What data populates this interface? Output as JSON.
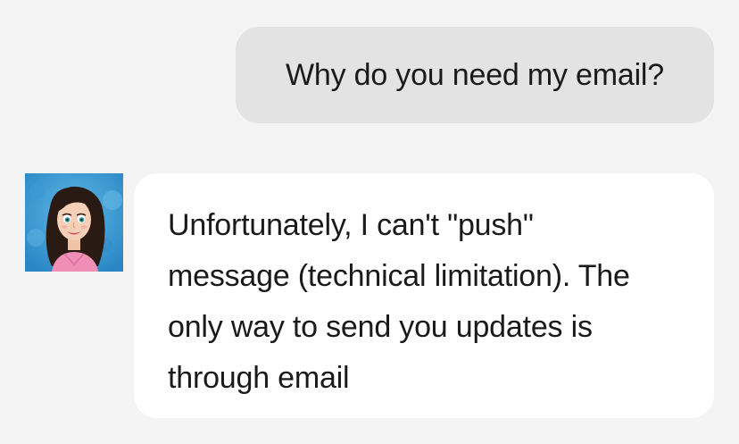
{
  "conversation": {
    "user_message": {
      "text": "Why do you need my email?"
    },
    "bot_message": {
      "avatar_icon": "cartoon-woman-avatar",
      "text": "Unfortunately, I can't \"push\"\nmessage (technical limitation). The\nonly way to send you updates is\nthrough email"
    }
  },
  "colors": {
    "background": "#f4f4f4",
    "user_bubble": "#e3e3e3",
    "bot_bubble": "#ffffff",
    "text": "#1a1a1a"
  }
}
